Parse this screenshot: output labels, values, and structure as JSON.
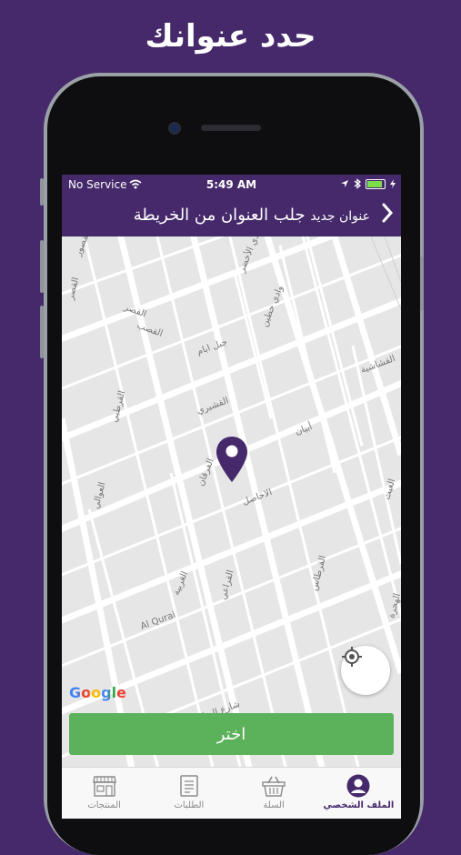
{
  "headline": "حدد عنوانك",
  "status_bar": {
    "carrier": "No Service",
    "time": "5:49 AM",
    "icons": [
      "wifi-icon",
      "location-arrow-icon",
      "bluetooth-icon",
      "battery-icon",
      "charging-icon"
    ]
  },
  "nav": {
    "title_small": "عنوان جديد",
    "title": "جلب العنوان من الخريطة",
    "back_icon": "chevron-right-icon"
  },
  "map": {
    "street_labels": [
      "القصور",
      "القصر",
      "القصر",
      "القصب",
      "الوادي الأخضر",
      "وادي حطين",
      "جبل ابام",
      "القشيري",
      "القشاشية",
      "أبيان",
      "الفرقان",
      "العوالي",
      "الاخاضل",
      "القرطبي",
      "الغربية",
      "القراعي",
      "Al Qurai",
      "شارع الرياض",
      "القرطاس",
      "الغيث",
      "الهجرة"
    ],
    "attribution": "Google",
    "locate_icon": "crosshair-location-icon",
    "pin_icon": "map-pin-icon"
  },
  "choose_button": "اختر",
  "colors": {
    "brand": "#45296a",
    "button": "#5cb25b"
  },
  "tabs": [
    {
      "label": "الملف الشخصي",
      "icon": "user-icon",
      "active": true
    },
    {
      "label": "السلة",
      "icon": "basket-icon",
      "active": false
    },
    {
      "label": "الطلبات",
      "icon": "orders-list-icon",
      "active": false
    },
    {
      "label": "المنتجات",
      "icon": "store-icon",
      "active": false
    }
  ]
}
